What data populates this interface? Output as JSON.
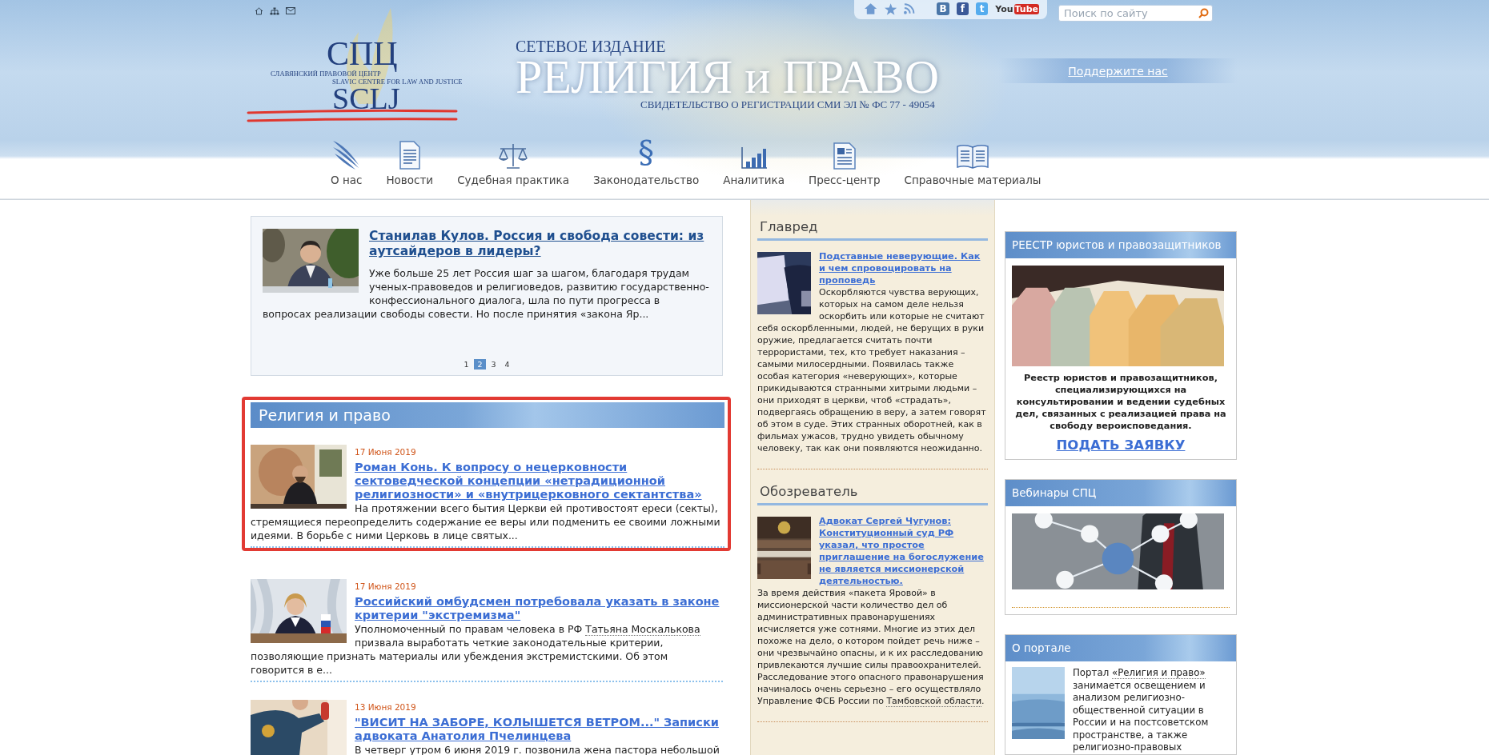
{
  "top_bar": {
    "social": [
      {
        "kind": "vk",
        "label": "B"
      },
      {
        "kind": "facebook",
        "label": "f"
      },
      {
        "kind": "twitter",
        "label": "t"
      },
      {
        "kind": "youtube",
        "label": "You",
        "label_box": "Tube"
      }
    ],
    "search": {
      "placeholder": "Поиск по сайту"
    }
  },
  "logo": {
    "abbr_ru": "СПЦ",
    "name_ru": "СЛАВЯНСКИЙ ПРАВОВОЙ ЦЕНТР",
    "name_en": "SLAVIC CENTRE FOR LAW AND JUSTICE",
    "abbr_en": "SCLJ"
  },
  "masthead": {
    "edition": "СЕТЕВОЕ ИЗДАНИЕ",
    "title": "РЕЛИГИЯ и ПРАВО",
    "registration": "СВИДЕТЕЛЬСТВО О РЕГИСТРАЦИИ СМИ ЭЛ № ФС 77 - 49054"
  },
  "support_link": "Поддержите нас",
  "nav": [
    {
      "label": "О нас"
    },
    {
      "label": "Новости"
    },
    {
      "label": "Судебная практика"
    },
    {
      "label": "Законодательство",
      "glyph": "§"
    },
    {
      "label": "Аналитика"
    },
    {
      "label": "Пресс-центр"
    },
    {
      "label": "Справочные материалы"
    }
  ],
  "featured": {
    "title": "Станилав Кулов. Россия и свобода совести: из аутсайдеров в лидеры?",
    "text": "Уже больше 25 лет Россия шаг за шагом, благодаря трудам ученых-правоведов и религиоведов, развитию государственно-конфессионального диалога, шла по пути прогресса в вопросах реализации свободы совести. Но после принятия «закона Яр...",
    "pages": [
      {
        "label": "1",
        "selected": false
      },
      {
        "label": "2",
        "selected": true
      },
      {
        "label": "3",
        "selected": false
      },
      {
        "label": "4",
        "selected": false
      }
    ]
  },
  "section": {
    "title": "Религия и право",
    "articles": [
      {
        "date": "17 Июня 2019",
        "title": "Роман Конь. К вопросу о нецерковности сектоведческой концепции «нетрадиционной религиозности» и «внутрицерковного сектантства»",
        "text": [
          {
            "kind": "plain",
            "text": "На протяжении всего бытия Церкви ей противостоят ереси (секты), стремящиеся переопределить содержание ее веры или подменить ее своими ложными идеями. В борьбе с ними Церковь в лице святых..."
          }
        ]
      },
      {
        "date": "17 Июня 2019",
        "title": "Российский омбудсмен потребовала указать в законе критерии \"экстремизма\"",
        "text": [
          {
            "kind": "plain",
            "text": "Уполномоченный по правам человека в РФ "
          },
          {
            "kind": "link",
            "text": "Татьяна Москалькова"
          },
          {
            "kind": "plain",
            "text": " призвала выработать четкие законодательные критерии, позволяющие признать материалы или убеждения экстремистскими. Об этом говорится в е..."
          }
        ]
      },
      {
        "date": "13 Июня 2019",
        "title": "\"ВИСИТ НА ЗАБОРЕ, КОЛЫШЕТСЯ ВЕТРОМ...\" Записки адвоката Анатолия Пчелинцева",
        "text": [
          {
            "kind": "plain",
            "text": "В четверг утром 6 июня 2019 г. позвонила жена пастора небольшой"
          }
        ]
      }
    ]
  },
  "middle_panels": [
    {
      "title": "Главред",
      "article_title": "Подставные неверующие. Как и чем спровоцировать на проповедь",
      "text": [
        {
          "kind": "plain",
          "text": "Оскорбляются чувства верующих, которых на самом деле нельзя оскорбить или которые не считают себя оскорбленными, людей, не берущих в руки оружие, предлагается считать почти террористами, тех, кто требует наказания – самыми милосердными. Появилась также особая категория «неверующих», которые прикидываются странными хитрыми людьми – они приходят в церкви, чтоб «страдать», подвергаясь обращению в веру, а затем говорят об этом в суде. Этих странных оборотней, как в фильмах ужасов, трудно увидеть обычному человеку, так как они появляются неожиданно."
        }
      ]
    },
    {
      "title": "Обозреватель",
      "article_title": "Адвокат Сергей Чугунов: Конституционный суд РФ указал, что простое приглашение на богослужение не является миссионерской деятельностью.",
      "text": [
        {
          "kind": "plain",
          "text": "За время действия «пакета Яровой» в миссионерской части количество дел об административных правонарушениях исчисляется уже сотнями. Многие из этих дел похоже на дело, о котором пойдет речь ниже – они чрезвычайно опасны, и к их расследованию привлекаются лучшие силы правоохранителей. Расследование этого опасного правонарушения начиналось очень серьезно – его осуществляло Управление ФСБ России по "
        },
        {
          "kind": "link",
          "text": "Тамбовской области"
        },
        {
          "kind": "plain",
          "text": "."
        }
      ]
    }
  ],
  "right_boxes": [
    {
      "kind": "registry",
      "title": "РЕЕСТР юристов и правозащитников",
      "text": "Реестр юристов и правозащитников, специализирующихся на консультировании и ведении судебных дел, связанных с реализацией права на свободу вероисповедания.",
      "link": "ПОДАТЬ ЗАЯВКУ"
    },
    {
      "kind": "webinar",
      "title": "Вебинары СПЦ"
    },
    {
      "kind": "about",
      "title": "О портале",
      "text": [
        {
          "kind": "plain",
          "text": "Портал "
        },
        {
          "kind": "link",
          "text": "«Религия и право»"
        },
        {
          "kind": "plain",
          "text": " занимается освещением и анализом религиозно-общественной ситуации в России и на постсоветском пространстве, а также религиозно-правовых"
        }
      ]
    }
  ]
}
